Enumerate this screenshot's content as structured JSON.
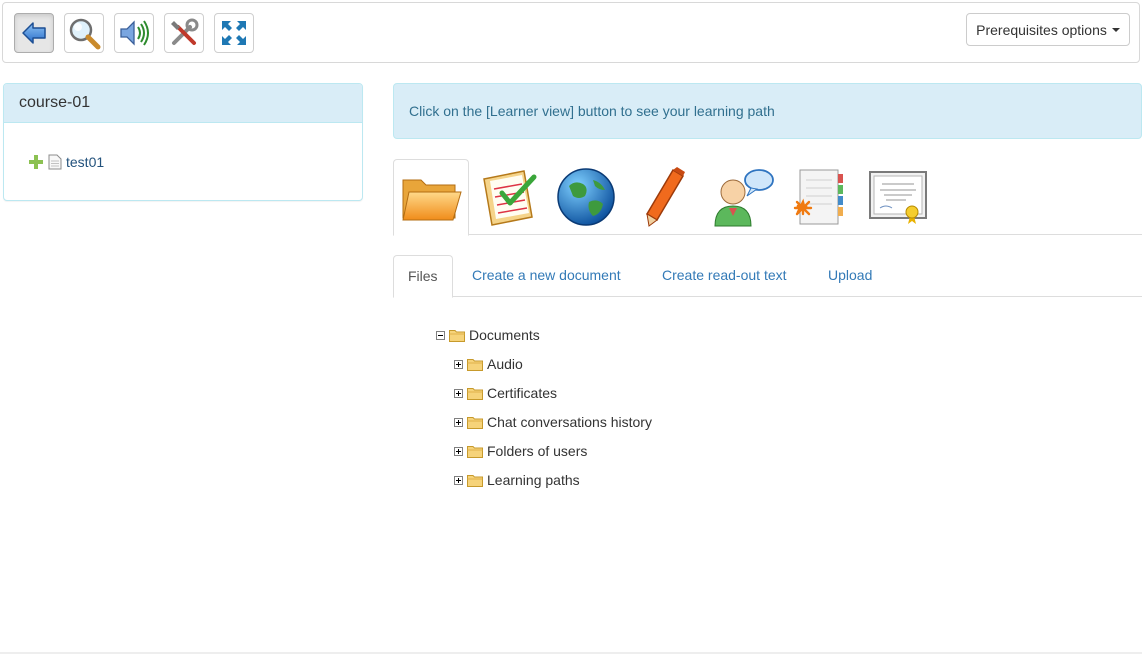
{
  "toolbar": {
    "buttons": [
      {
        "icon": "back-arrow-icon",
        "active": true
      },
      {
        "icon": "magnifier-icon",
        "active": false
      },
      {
        "icon": "speaker-icon",
        "active": false
      },
      {
        "icon": "tools-icon",
        "active": false
      },
      {
        "icon": "expand-icon",
        "active": false
      }
    ],
    "prerequisites_label": "Prerequisites options"
  },
  "course_panel": {
    "title": "course-01",
    "items": [
      {
        "label": "test01",
        "icons": [
          "move-cross-icon",
          "document-icon"
        ]
      }
    ]
  },
  "info_alert": {
    "text": "Click on the [Learner view] button to see your learning path"
  },
  "icon_tabs": [
    {
      "icon": "folder-icon",
      "active": true
    },
    {
      "icon": "quiz-checklist-icon",
      "active": false
    },
    {
      "icon": "globe-link-icon",
      "active": false
    },
    {
      "icon": "pen-assignment-icon",
      "active": false
    },
    {
      "icon": "forum-user-icon",
      "active": false
    },
    {
      "icon": "notebook-section-icon",
      "active": false
    },
    {
      "icon": "certificate-icon",
      "active": false
    }
  ],
  "text_tabs": [
    {
      "label": "Files",
      "active": true
    },
    {
      "label": "Create a new document",
      "active": false
    },
    {
      "label": "Create read-out text",
      "active": false
    },
    {
      "label": "Upload",
      "active": false
    }
  ],
  "tree": {
    "root": "Documents",
    "children": [
      "Audio",
      "Certificates",
      "Chat conversations history",
      "Folders of users",
      "Learning paths"
    ]
  },
  "colors": {
    "info_bg": "#d9edf7",
    "info_border": "#bce8f1",
    "info_text": "#31708f",
    "link": "#337ab7"
  }
}
